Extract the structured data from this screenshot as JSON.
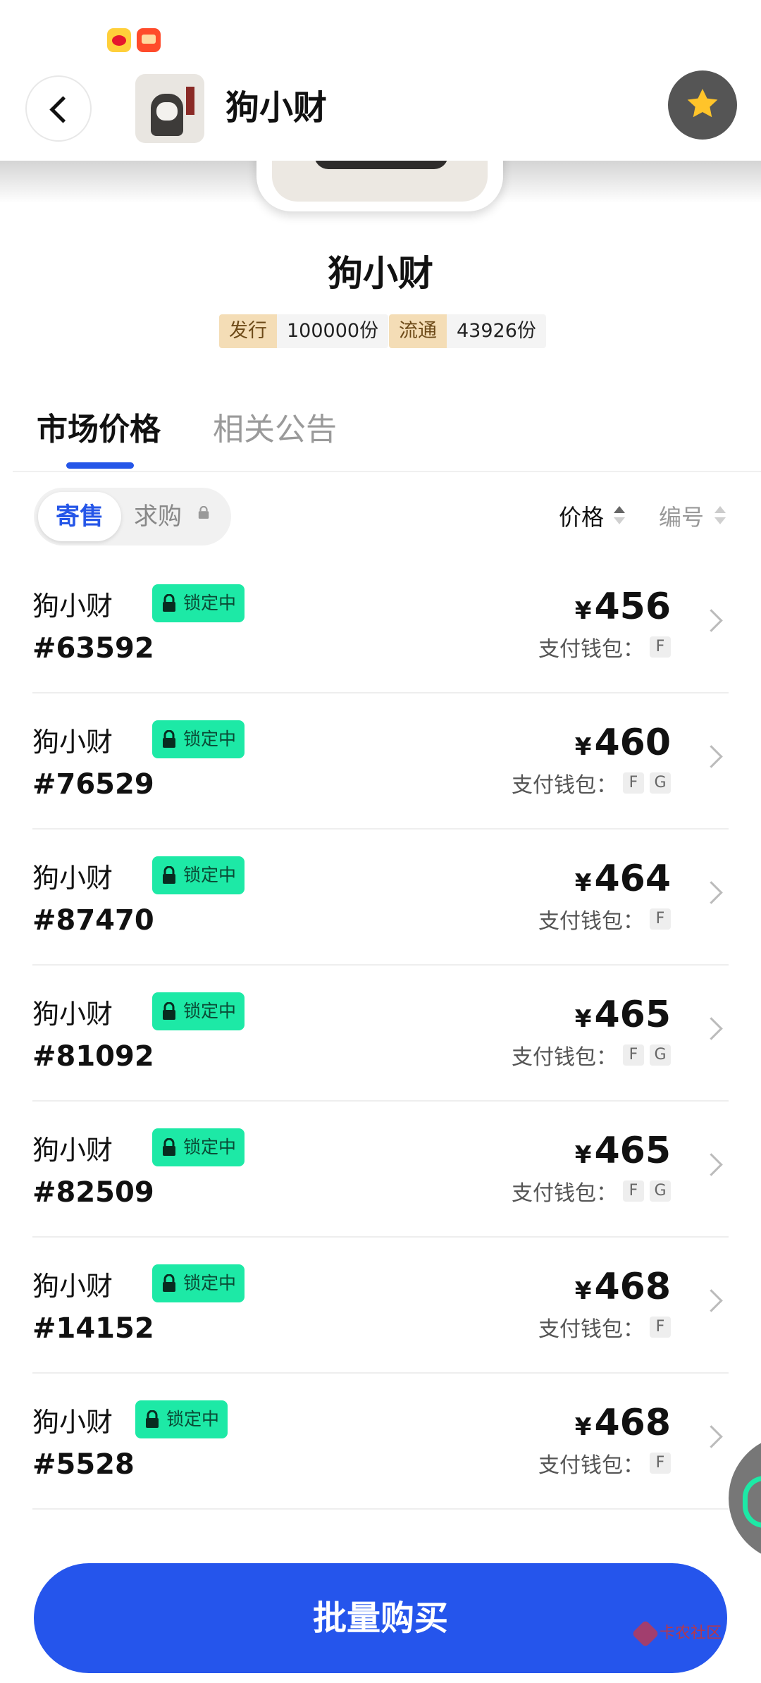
{
  "header": {
    "title": "狗小财"
  },
  "hero": {
    "name": "狗小财",
    "issue_label": "发行",
    "issue_value": "100000份",
    "circulation_label": "流通",
    "circulation_value": "43926份"
  },
  "tabs": [
    {
      "label": "市场价格",
      "active": true
    },
    {
      "label": "相关公告",
      "active": false
    }
  ],
  "segment": {
    "sell_label": "寄售",
    "buy_label": "求购"
  },
  "sort": {
    "price_label": "价格",
    "number_label": "编号"
  },
  "listings": [
    {
      "name": "狗小财",
      "number": "#63592",
      "badge": "锁定中",
      "currency": "¥",
      "price": "456",
      "wallet_label": "支付钱包：",
      "wallets": [
        "F"
      ]
    },
    {
      "name": "狗小财",
      "number": "#76529",
      "badge": "锁定中",
      "currency": "¥",
      "price": "460",
      "wallet_label": "支付钱包：",
      "wallets": [
        "F",
        "G"
      ]
    },
    {
      "name": "狗小财",
      "number": "#87470",
      "badge": "锁定中",
      "currency": "¥",
      "price": "464",
      "wallet_label": "支付钱包：",
      "wallets": [
        "F"
      ]
    },
    {
      "name": "狗小财",
      "number": "#81092",
      "badge": "锁定中",
      "currency": "¥",
      "price": "465",
      "wallet_label": "支付钱包：",
      "wallets": [
        "F",
        "G"
      ]
    },
    {
      "name": "狗小财",
      "number": "#82509",
      "badge": "锁定中",
      "currency": "¥",
      "price": "465",
      "wallet_label": "支付钱包：",
      "wallets": [
        "F",
        "G"
      ]
    },
    {
      "name": "狗小财",
      "number": "#14152",
      "badge": "锁定中",
      "currency": "¥",
      "price": "468",
      "wallet_label": "支付钱包：",
      "wallets": [
        "F"
      ]
    },
    {
      "name": "狗小财",
      "number": "#5528",
      "badge": "锁定中",
      "currency": "¥",
      "price": "468",
      "wallet_label": "支付钱包：",
      "wallets": [
        "F"
      ]
    }
  ],
  "bottom": {
    "bulk_buy_label": "批量购买",
    "watermark": "卡农社区"
  },
  "colors": {
    "accent": "#2555ec",
    "lock_badge": "#1de9a6",
    "favorite": "#ffc42a"
  },
  "icons": {
    "back": "chevron-left-icon",
    "favorite": "star-icon",
    "lock": "lock-icon",
    "row_arrow": "chevron-right-icon"
  }
}
